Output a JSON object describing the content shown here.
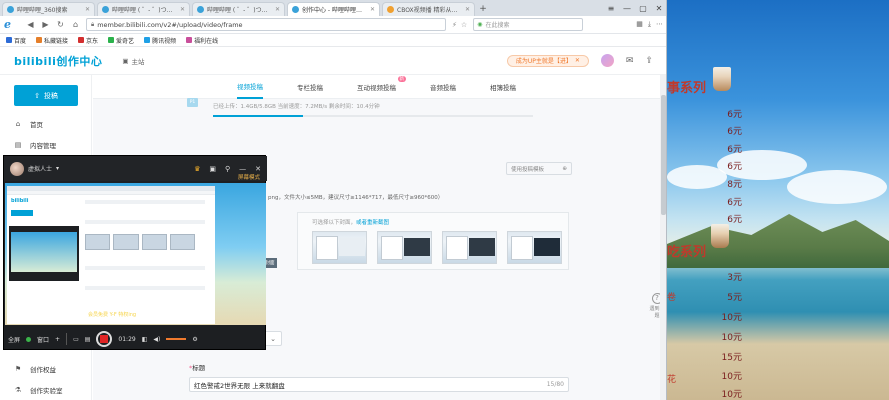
{
  "browser": {
    "tabs": [
      {
        "label": "哔哩哔哩_360搜索",
        "active": false
      },
      {
        "label": "哔哩哔哩 ( ゜- ゜)つロ 干杯~-bili",
        "active": false
      },
      {
        "label": "哔哩哔哩 ( ゜- ゜)つロ 干杯~-bi",
        "active": false
      },
      {
        "label": "创作中心 - 哔哩哔哩弹幕视频网",
        "active": true
      },
      {
        "label": "CBOX视频播 精彩从现在开始",
        "active": false
      }
    ],
    "new_tab": "+",
    "address": "member.bilibili.com/v2#/upload/video/frame",
    "search_placeholder": "在此搜索",
    "bookmarks": [
      "百度",
      "私藏链接",
      "京东",
      "爱奇艺",
      "腾讯视频",
      "福利在线"
    ]
  },
  "header": {
    "logo": "bilibili创作中心",
    "home": "主站",
    "up_button": "成为UP主就是【进】",
    "avatar": "用户头像"
  },
  "sidebar": {
    "upload_button": "投稿",
    "items": [
      "首页",
      "内容管理",
      "创作权益",
      "创作实验室"
    ]
  },
  "upload": {
    "tabs": [
      "视频投稿",
      "专栏投稿",
      "互动视频投稿",
      "音频投稿",
      "相簿投稿"
    ],
    "new_badge": "新",
    "status_line": "已经上传：1.4GB/5.8GB      当前速度：7.2MB/s      剩余时间：10.4分钟",
    "progress_percent": 28,
    "px_badge": "P1",
    "template_button": "使用投稿模板",
    "cover_tip": "png，文件大小≤5MB，建议尺寸≥1146*717，最低尺寸≥960*600）",
    "thumbs_tip_prefix": "可选择以下封面，",
    "thumbs_tip_link": "或者重新截图",
    "cover_label": "封面",
    "title_label": "标题",
    "required_mark": "*",
    "title_value": "红色警戒2世界无限 上来就翻盘",
    "title_count": "15/80",
    "help_label": "遇到问题"
  },
  "recorder": {
    "user": "虚拟人士",
    "switch_label": "屏幕模式",
    "promo": "会员免费 Y-F 特权ing",
    "fullscreen": "全屏",
    "window": "窗口",
    "time": "01:29"
  },
  "wallpaper": {
    "heading_top": "事系列",
    "heading_mid": "吃系列",
    "snack_a": "卷",
    "snack_b": "花",
    "prices_top": [
      "6元",
      "6元",
      "6元",
      "6元",
      "8元",
      "6元",
      "6元"
    ],
    "prices_bottom": [
      "3元",
      "5元",
      "10元",
      "10元",
      "15元",
      "10元",
      "10元"
    ]
  }
}
